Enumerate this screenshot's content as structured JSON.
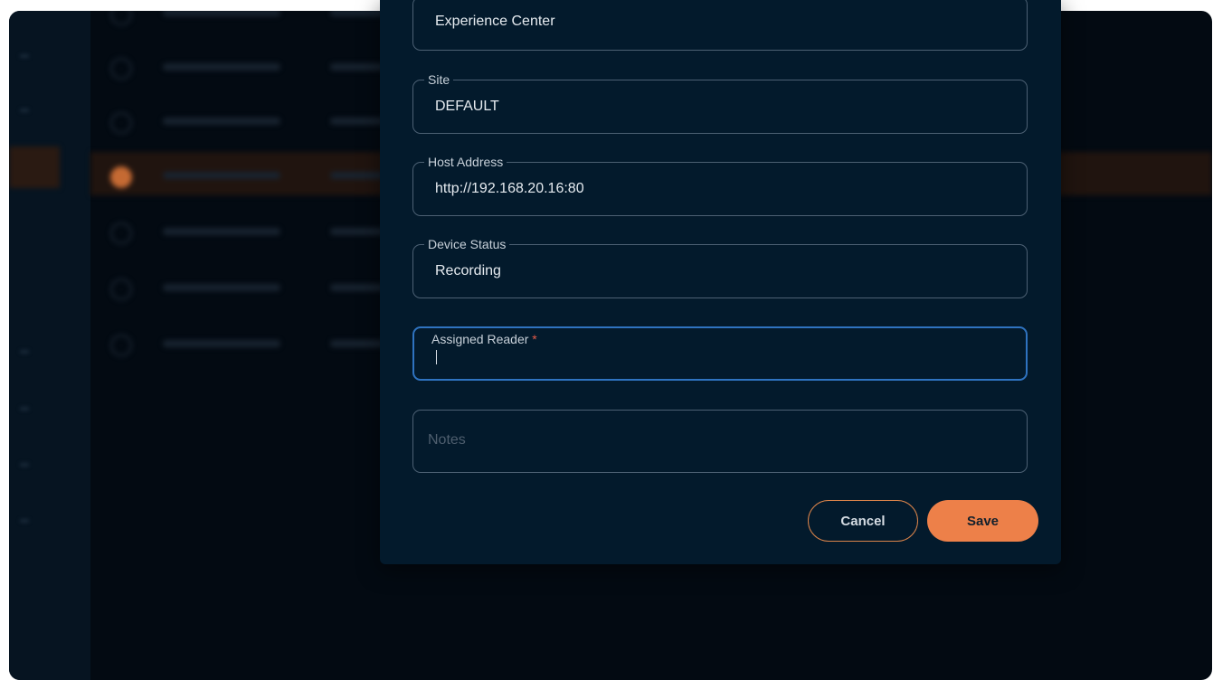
{
  "dialog": {
    "fields": [
      {
        "label": "",
        "value": "Experience Center"
      },
      {
        "label": "Site",
        "value": "DEFAULT"
      },
      {
        "label": "Host Address",
        "value": "http://192.168.20.16:80"
      },
      {
        "label": "Device Status",
        "value": "Recording"
      },
      {
        "label": "Assigned Reader",
        "required_mark": "*",
        "value": ""
      },
      {
        "placeholder": "Notes",
        "value": ""
      }
    ],
    "cancel_label": "Cancel",
    "save_label": "Save"
  },
  "colors": {
    "accent": "#ed8049",
    "focus": "#2f73c0",
    "dialog_bg": "#031a2c",
    "required": "#e35b49"
  }
}
